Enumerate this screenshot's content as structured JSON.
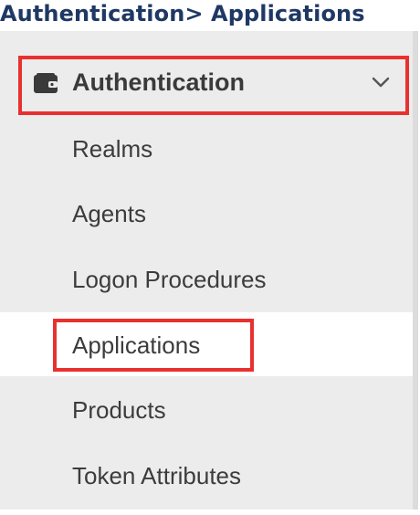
{
  "caption": "Authentication> Applications",
  "sidebar": {
    "group": {
      "label": "Authentication",
      "icon": "wallet-icon",
      "expand_icon": "chevron-down-icon"
    },
    "items": [
      {
        "label": "Realms",
        "active": false
      },
      {
        "label": "Agents",
        "active": false
      },
      {
        "label": "Logon Procedures",
        "active": false
      },
      {
        "label": "Applications",
        "active": true
      },
      {
        "label": "Products",
        "active": false
      },
      {
        "label": "Token Attributes",
        "active": false
      }
    ]
  },
  "colors": {
    "caption_text": "#1f3864",
    "highlight_box": "#e8312f",
    "sidebar_bg": "#ececec",
    "active_bg": "#ffffff",
    "item_text": "#3c3c3c"
  }
}
